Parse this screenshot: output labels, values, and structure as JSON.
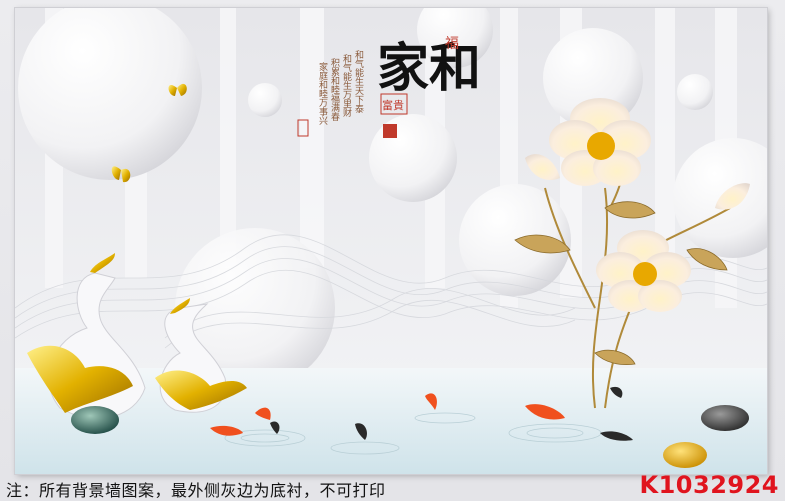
{
  "artwork": {
    "title": "家和",
    "seal_fu": "福",
    "stamp_fugui": "富貴",
    "poem_lines": [
      "和气能生天下泰",
      "和气能生万里财",
      "积累和睦福满春",
      "家庭和睦万事兴"
    ]
  },
  "footer": {
    "notice": "注：所有背景墙图案，最外侧灰边为底衬，不可打印",
    "product_code": "K1032924"
  },
  "colors": {
    "code_red": "#e0141e",
    "gold": "#d9a400",
    "koi_orange": "#f0501e"
  }
}
